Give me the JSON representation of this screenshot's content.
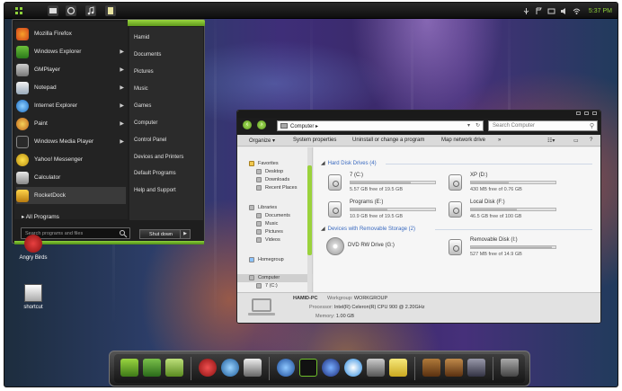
{
  "taskbar": {
    "clock": "5:37 PM",
    "buttons": [
      "start-icon",
      "folder-icon",
      "ie-icon",
      "music-icon",
      "notes-icon"
    ]
  },
  "start_menu": {
    "programs": [
      {
        "label": "Mozilla Firefox",
        "icon": "firefox-icon",
        "arrow": ""
      },
      {
        "label": "Windows Explorer",
        "icon": "explorer-icon",
        "arrow": "▶"
      },
      {
        "label": "GMPlayer",
        "icon": "gmplayer-icon",
        "arrow": "▶"
      },
      {
        "label": "Notepad",
        "icon": "notepad-icon",
        "arrow": "▶"
      },
      {
        "label": "Internet Explorer",
        "icon": "ie-icon",
        "arrow": "▶"
      },
      {
        "label": "Paint",
        "icon": "paint-icon",
        "arrow": "▶"
      },
      {
        "label": "Windows Media Player",
        "icon": "wmp-icon",
        "arrow": "▶"
      },
      {
        "label": "Yahoo! Messenger",
        "icon": "yahoo-icon",
        "arrow": ""
      },
      {
        "label": "Calculator",
        "icon": "calculator-icon",
        "arrow": ""
      },
      {
        "label": "RocketDock",
        "icon": "rocketdock-icon",
        "arrow": ""
      }
    ],
    "all_programs": "All Programs",
    "right_links": [
      "Hamid",
      "Documents",
      "Pictures",
      "Music",
      "Games",
      "Computer",
      "Control Panel",
      "Devices and Printers",
      "Default Programs",
      "Help and Support"
    ],
    "search_placeholder": "Search programs and files",
    "shutdown_label": "Shut down",
    "shutdown_arrow": "▶"
  },
  "desktop_icons": [
    {
      "label": "Angry Birds"
    },
    {
      "label": "shortcut"
    }
  ],
  "explorer": {
    "address": "Computer ▸",
    "address_dropdown": "▾",
    "address_refresh": "↻",
    "search_placeholder": "Search Computer",
    "toolbar": [
      "Organize ▾",
      "System properties",
      "Uninstall or change a program",
      "Map network drive",
      "»"
    ],
    "nav": {
      "favorites_header": "Favorites",
      "favorites": [
        "Desktop",
        "Downloads",
        "Recent Places"
      ],
      "libraries_header": "Libraries",
      "libraries": [
        "Documents",
        "Music",
        "Pictures",
        "Videos"
      ],
      "homegroup": "Homegroup",
      "computer": "Computer",
      "drive": "7 (C:)"
    },
    "groups": {
      "hdd": "Hard Disk Drives (4)",
      "removable": "Devices with Removable Storage (2)"
    },
    "drives": [
      {
        "name": "7 (C:)",
        "free": "5.57 GB free of 19.5 GB",
        "used_pct": 71
      },
      {
        "name": "XP (D:)",
        "free": "430 MB free of 0.76 GB",
        "used_pct": 45
      },
      {
        "name": "Programs (E:)",
        "free": "10.9 GB free of 19.5 GB",
        "used_pct": 44
      },
      {
        "name": "Local Disk (F:)",
        "free": "46.5 GB free of 100 GB",
        "used_pct": 54
      }
    ],
    "removable": [
      {
        "name": "DVD RW Drive (G:)"
      },
      {
        "name": "Removable Disk (I:)",
        "free": "527 MB free of 14.9 GB",
        "used_pct": 96
      }
    ],
    "details": {
      "computer_name": "HAMID-PC",
      "workgroup_label": "Workgroup:",
      "workgroup": "WORKGROUP",
      "processor_label": "Processor:",
      "processor": "Intel(R) Celeron(R) CPU      900 @ 2.20GHz",
      "memory_label": "Memory:",
      "memory": "1.00 GB"
    }
  },
  "dock": {
    "icons": [
      "desktop-icon",
      "home-folder-icon",
      "files-icon",
      "angry-birds-icon",
      "steering-icon",
      "camera-icon",
      "globe-icon",
      "media-player-icon",
      "disc-icon",
      "browser-icon",
      "control-panel-icon",
      "notes-icon",
      "coffee-icon",
      "coffee2-icon",
      "monitor-icon",
      "trash-icon"
    ]
  }
}
